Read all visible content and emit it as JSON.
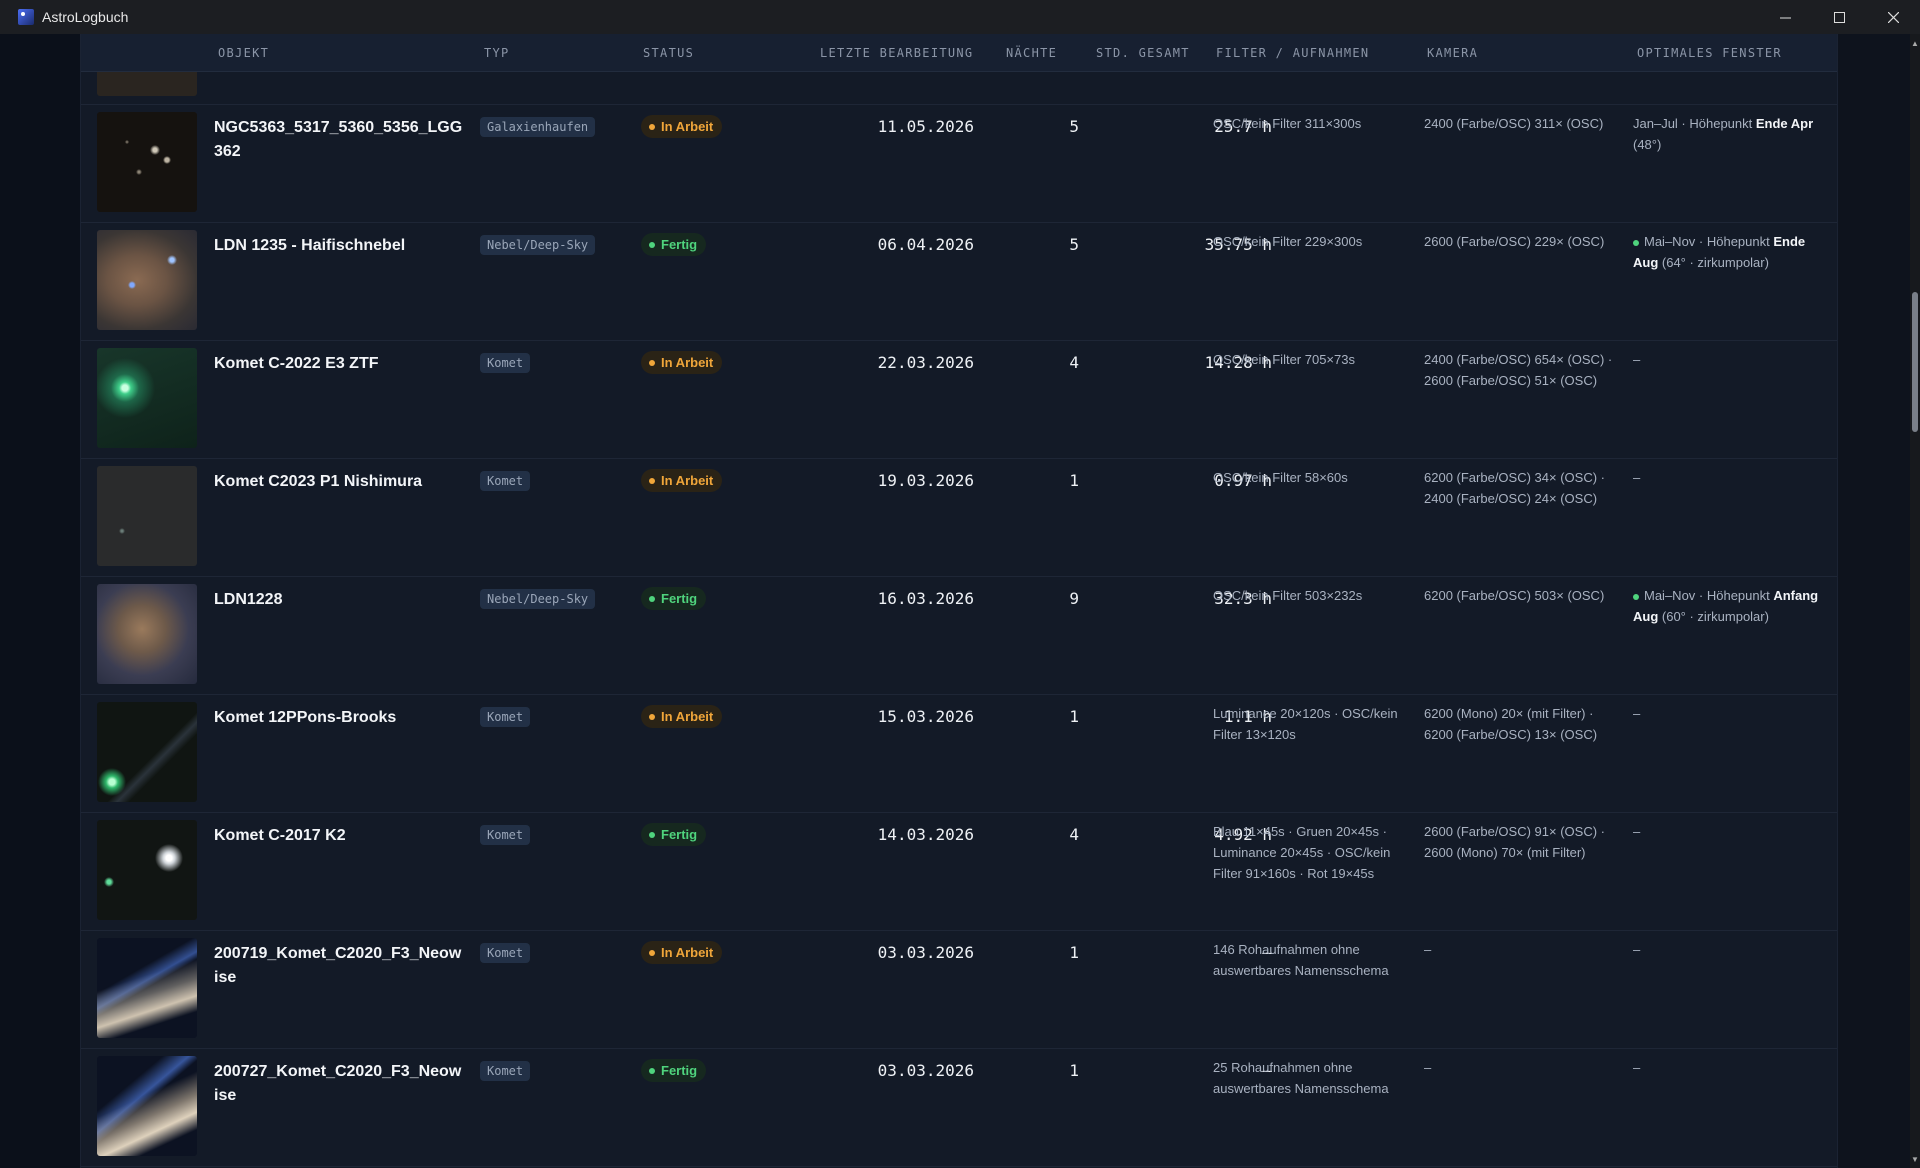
{
  "window": {
    "title": "AstroLogbuch"
  },
  "columns": {
    "objekt": "OBJEKT",
    "typ": "TYP",
    "status": "STATUS",
    "letzte": "LETZTE BEARBEITUNG",
    "naechte": "NÄCHTE",
    "std": "STD. GESAMT",
    "filter": "FILTER / AUFNAHMEN",
    "kamera": "KAMERA",
    "fenster": "OPTIMALES FENSTER"
  },
  "rows": [
    {
      "name": "NGC5363_5317_5360_5356_LGG362",
      "type": "Galaxienhaufen",
      "status": "In Arbeit",
      "status_kind": "arbeit",
      "date": "11.05.2026",
      "nights": "5",
      "hours": "25.7 h",
      "filters": "OSC/kein Filter 311×300s",
      "camera": "2400 (Farbe/OSC) 311× (OSC)",
      "window_dot": false,
      "window_pre": "Jan–Jul · Höhepunkt ",
      "window_bold": "Ende Apr",
      "window_post": " (48°)",
      "thumb": "galaxies"
    },
    {
      "name": "LDN 1235 - Haifischnebel",
      "type": "Nebel/Deep-Sky",
      "status": "Fertig",
      "status_kind": "fertig",
      "date": "06.04.2026",
      "nights": "5",
      "hours": "35.75 h",
      "filters": "OSC/kein Filter 229×300s",
      "camera": "2600 (Farbe/OSC) 229× (OSC)",
      "window_dot": true,
      "window_pre": "Mai–Nov · Höhepunkt ",
      "window_bold": "Ende Aug",
      "window_post": " (64° · zirkumpolar)",
      "thumb": "nebula"
    },
    {
      "name": "Komet C-2022 E3 ZTF",
      "type": "Komet",
      "status": "In Arbeit",
      "status_kind": "arbeit",
      "date": "22.03.2026",
      "nights": "4",
      "hours": "14.28 h",
      "filters": "OSC/kein Filter 705×73s",
      "camera": "2400 (Farbe/OSC) 654× (OSC) · 2600 (Farbe/OSC) 51× (OSC)",
      "window_dot": false,
      "window_pre": "–",
      "window_bold": "",
      "window_post": "",
      "thumb": "comet-green"
    },
    {
      "name": "Komet C2023 P1 Nishimura",
      "type": "Komet",
      "status": "In Arbeit",
      "status_kind": "arbeit",
      "date": "19.03.2026",
      "nights": "1",
      "hours": "0.97 h",
      "filters": "OSC/kein Filter 58×60s",
      "camera": "6200 (Farbe/OSC) 34× (OSC) · 2400 (Farbe/OSC) 24× (OSC)",
      "window_dot": false,
      "window_pre": "–",
      "window_bold": "",
      "window_post": "",
      "thumb": "dark"
    },
    {
      "name": "LDN1228",
      "type": "Nebel/Deep-Sky",
      "status": "Fertig",
      "status_kind": "fertig",
      "date": "16.03.2026",
      "nights": "9",
      "hours": "32.3 h",
      "filters": "OSC/kein Filter 503×232s",
      "camera": "6200 (Farbe/OSC) 503× (OSC)",
      "window_dot": true,
      "window_pre": "Mai–Nov · Höhepunkt ",
      "window_bold": "Anfang Aug",
      "window_post": " (60° · zirkumpolar)",
      "thumb": "dust"
    },
    {
      "name": "Komet 12PPons-Brooks",
      "type": "Komet",
      "status": "In Arbeit",
      "status_kind": "arbeit",
      "date": "15.03.2026",
      "nights": "1",
      "hours": "1.1 h",
      "filters": "Luminance 20×120s · OSC/kein Filter 13×120s",
      "camera": "6200 (Mono) 20× (mit Filter) · 6200 (Farbe/OSC) 13× (OSC)",
      "window_dot": false,
      "window_pre": "–",
      "window_bold": "",
      "window_post": "",
      "thumb": "comet-tail"
    },
    {
      "name": "Komet C-2017 K2",
      "type": "Komet",
      "status": "Fertig",
      "status_kind": "fertig",
      "date": "14.03.2026",
      "nights": "4",
      "hours": "4.92 h",
      "filters": "Blau 11×45s · Gruen 20×45s · Luminance 20×45s · OSC/kein Filter 91×160s · Rot 19×45s",
      "camera": "2600 (Farbe/OSC) 91× (OSC) · 2600 (Mono) 70× (mit Filter)",
      "window_dot": false,
      "window_pre": "–",
      "window_bold": "",
      "window_post": "",
      "thumb": "cluster"
    },
    {
      "name": "200719_Komet_C2020_F3_Neowise",
      "type": "Komet",
      "status": "In Arbeit",
      "status_kind": "arbeit",
      "date": "03.03.2026",
      "nights": "1",
      "hours": "–",
      "filters": "146 Rohaufnahmen ohne auswertbares Namensschema",
      "camera": "–",
      "window_dot": false,
      "window_pre": "–",
      "window_bold": "",
      "window_post": "",
      "thumb": "neowise"
    },
    {
      "name": "200727_Komet_C2020_F3_Neowise",
      "type": "Komet",
      "status": "Fertig",
      "status_kind": "fertig",
      "date": "03.03.2026",
      "nights": "1",
      "hours": "–",
      "filters": "25 Rohaufnahmen ohne auswertbares Namensschema",
      "camera": "–",
      "window_dot": false,
      "window_pre": "–",
      "window_bold": "",
      "window_post": "",
      "thumb": "neowise2"
    }
  ]
}
